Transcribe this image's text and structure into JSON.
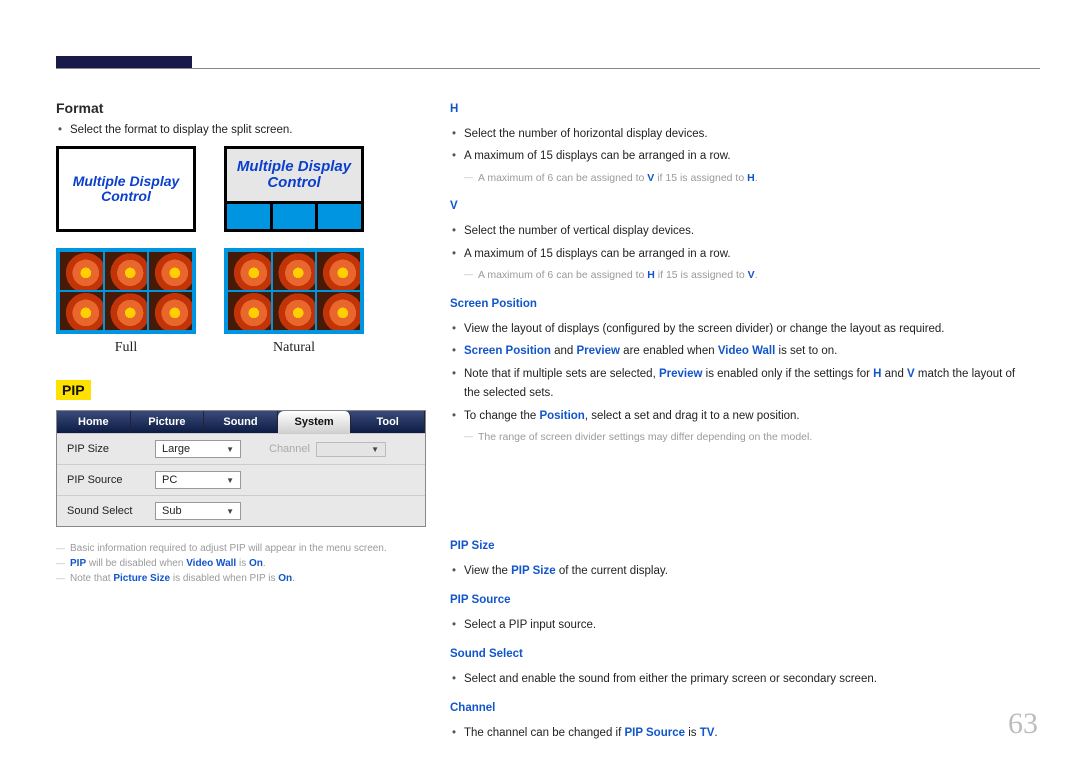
{
  "page_number": "63",
  "left": {
    "format_heading": "Format",
    "format_bullet": "Select the format to display the split screen.",
    "diagram_text": "Multiple Display Control",
    "label_full": "Full",
    "label_natural": "Natural",
    "pip_heading": "PIP",
    "menu": {
      "tabs": [
        "Home",
        "Picture",
        "Sound",
        "System",
        "Tool"
      ],
      "rows": {
        "pip_size_label": "PIP Size",
        "pip_size_value": "Large",
        "pip_source_label": "PIP Source",
        "pip_source_value": "PC",
        "sound_select_label": "Sound Select",
        "sound_select_value": "Sub",
        "channel_label": "Channel"
      }
    },
    "notes": {
      "n1a": "Basic information required to adjust PIP will appear in the menu screen.",
      "n2_pre": "PIP",
      "n2_mid": " will be disabled when ",
      "n2_vw": "Video Wall",
      "n2_is": " is ",
      "n2_on": "On",
      "n2_end": ".",
      "n3_pre": "Note that ",
      "n3_ps": "Picture Size",
      "n3_mid": " is disabled when PIP is ",
      "n3_on": "On",
      "n3_end": "."
    }
  },
  "right": {
    "h": "H",
    "h_b1": "Select the number of horizontal display devices.",
    "h_b2": "A maximum of 15 displays can be arranged in a row.",
    "h_note_a": "A maximum of 6 can be assigned to ",
    "h_note_v": "V",
    "h_note_b": " if 15 is assigned to ",
    "h_note_h": "H",
    "h_note_end": ".",
    "v": "V",
    "v_b1": "Select the number of vertical display devices.",
    "v_b2": "A maximum of 15 displays can be arranged in a row.",
    "v_note_a": "A maximum of 6 can be assigned to ",
    "v_note_h": "H",
    "v_note_b": " if 15 is assigned to ",
    "v_note_v": "V",
    "v_note_end": ".",
    "sp": "Screen Position",
    "sp_b1": "View the layout of displays (configured by the screen divider) or change the layout as required.",
    "sp_b2_a": "Screen Position",
    "sp_b2_and": " and ",
    "sp_b2_b": "Preview",
    "sp_b2_c": " are enabled when ",
    "sp_b2_d": "Video Wall",
    "sp_b2_e": " is set to on.",
    "sp_b3_a": "Note that if multiple sets are selected, ",
    "sp_b3_b": "Preview",
    "sp_b3_c": " is enabled only if the settings for ",
    "sp_b3_d": "H",
    "sp_b3_e": " and ",
    "sp_b3_f": "V",
    "sp_b3_g": " match the layout of the selected sets.",
    "sp_b4_a": "To change the ",
    "sp_b4_b": "Position",
    "sp_b4_c": ", select a set and drag it to a new position.",
    "sp_note": "The range of screen divider settings may differ depending on the model.",
    "pip_size": "PIP Size",
    "pip_size_b_a": "View the ",
    "pip_size_b_b": "PIP Size",
    "pip_size_b_c": " of the current display.",
    "pip_src": "PIP Source",
    "pip_src_b": "Select a PIP input source.",
    "ss": "Sound Select",
    "ss_b": "Select and enable the sound from either the primary screen or secondary screen.",
    "ch": "Channel",
    "ch_b_a": "The channel can be changed if ",
    "ch_b_b": "PIP Source",
    "ch_b_c": " is ",
    "ch_b_d": "TV",
    "ch_b_e": "."
  }
}
